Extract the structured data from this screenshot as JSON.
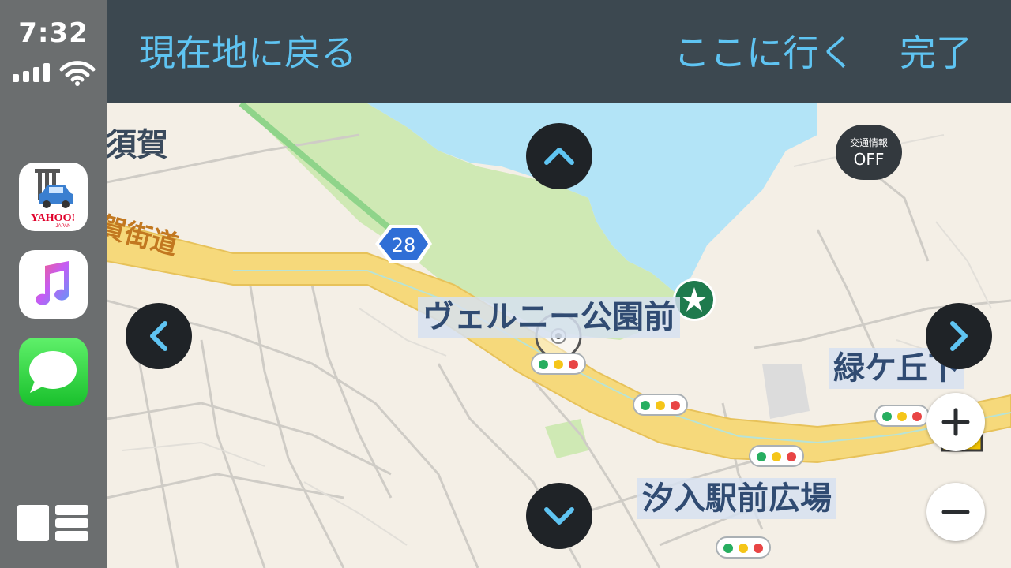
{
  "status": {
    "time": "7:32"
  },
  "sidebar": {
    "apps": [
      {
        "name": "Yahoo! カーナビ",
        "logo_text": "YAHOO!",
        "logo_subtext": "JAPAN"
      },
      {
        "name": "Music"
      },
      {
        "name": "Messages"
      }
    ]
  },
  "topbar": {
    "return_label": "現在地に戻る",
    "go_label": "ここに行く",
    "done_label": "完了"
  },
  "map": {
    "route_badge": "28",
    "labels": {
      "suga": "須賀",
      "kaido": "賀街道",
      "park": "ヴェルニー公園前",
      "midorigaoka": "緑ケ丘下",
      "shionyu": "汐入駅前広場"
    },
    "traffic_toggle": {
      "label": "交通情報",
      "state": "OFF"
    },
    "colors": {
      "water": "#b3e4f7",
      "park": "#cfe9b4",
      "highway": "#f6d97b",
      "land": "#f4efe6",
      "accent": "#5fc4f2"
    }
  }
}
